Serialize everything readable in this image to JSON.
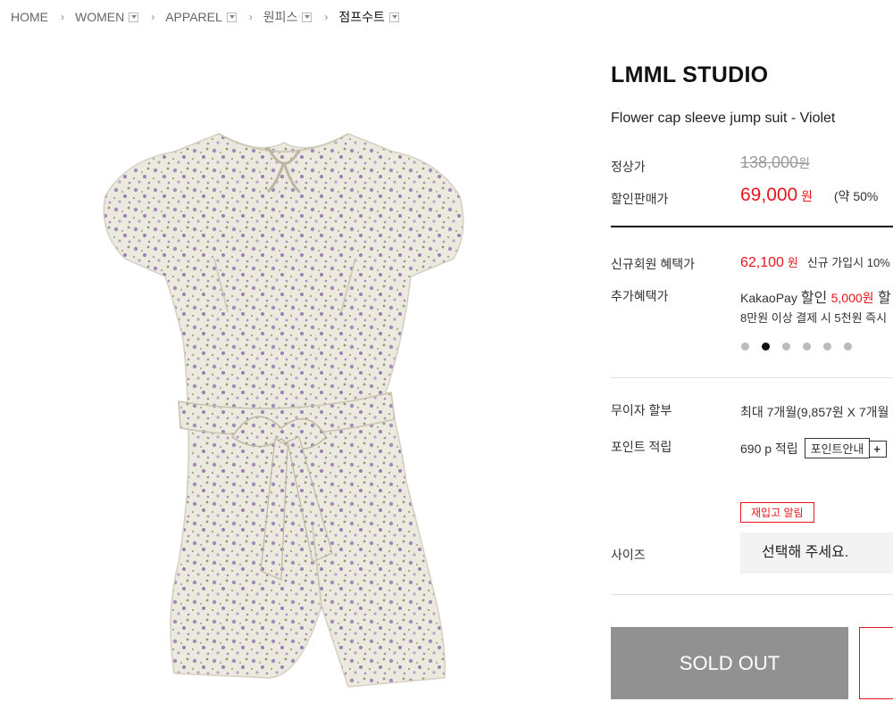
{
  "breadcrumb": [
    {
      "label": "HOME",
      "dropdown": false
    },
    {
      "label": "WOMEN",
      "dropdown": true
    },
    {
      "label": "APPAREL",
      "dropdown": true
    },
    {
      "label": "원피스",
      "dropdown": true
    },
    {
      "label": "점프수트",
      "dropdown": true
    }
  ],
  "product": {
    "brand": "LMML STUDIO",
    "name": "Flower cap sleeve jump suit - Violet",
    "regular_price_label": "정상가",
    "regular_price": "138,000",
    "regular_price_unit": "원",
    "sale_price_label": "할인판매가",
    "sale_price": "69,000",
    "sale_price_unit": "원",
    "discount_note": "(약 50%",
    "member_label": "신규회원 혜택가",
    "member_price": "62,100",
    "member_unit": "원",
    "member_note": "신규 가입시 10%",
    "extra_label": "추가혜택가",
    "extra_line1_prefix": "KakaoPay ",
    "extra_line1_bold": "할인 ",
    "extra_line1_red": "5,000원",
    "extra_line1_suffix": " 할",
    "extra_line2": "8만원 이상 결제 시 5천원 즉시",
    "installment_label": "무이자 할부",
    "installment_value": "최대 7개월(9,857원 X 7개월",
    "point_label": "포인트 적립",
    "point_value": "690 p 적립",
    "point_button": "포인트안내",
    "point_plus": "+",
    "restock_button": "재입고 알림",
    "size_label": "사이즈",
    "size_placeholder": "선택해 주세요.",
    "soldout_button": "SOLD OUT"
  },
  "carousel": {
    "count": 6,
    "active_index": 1
  },
  "colors": {
    "accent": "#e8161c",
    "soldout": "#919191",
    "fabric": "#ece9de",
    "flower": "#9b7fb0"
  }
}
